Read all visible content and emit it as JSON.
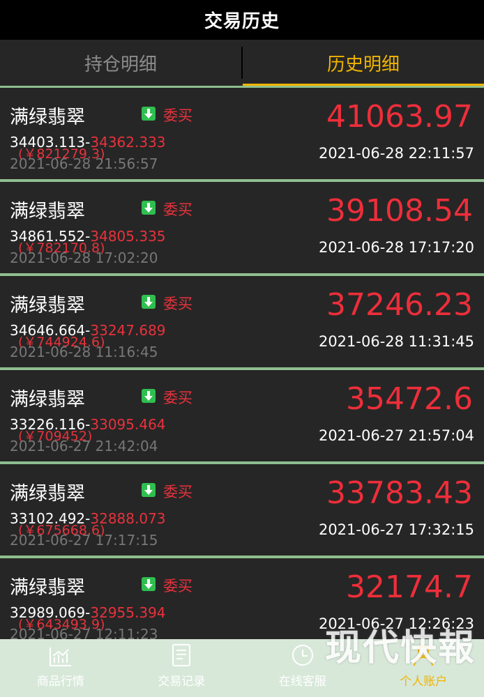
{
  "header": {
    "title": "交易历史"
  },
  "tabs": [
    {
      "label": "持仓明细",
      "active": false
    },
    {
      "label": "历史明细",
      "active": true
    }
  ],
  "trades": [
    {
      "name": "满绿翡翠",
      "type": "委买",
      "open_price": "34403.113-",
      "close_price": "34362.333",
      "amount": "(￥821279.3)",
      "open_time": "2021-06-28 21:56:57",
      "value": "41063.97",
      "close_time": "2021-06-28 22:11:57"
    },
    {
      "name": "满绿翡翠",
      "type": "委买",
      "open_price": "34861.552-",
      "close_price": "34805.335",
      "amount": "(￥782170.8)",
      "open_time": "2021-06-28 17:02:20",
      "value": "39108.54",
      "close_time": "2021-06-28 17:17:20"
    },
    {
      "name": "满绿翡翠",
      "type": "委买",
      "open_price": "34646.664-",
      "close_price": "33247.689",
      "amount": "(￥744924.6)",
      "open_time": "2021-06-28 11:16:45",
      "value": "37246.23",
      "close_time": "2021-06-28 11:31:45"
    },
    {
      "name": "满绿翡翠",
      "type": "委买",
      "open_price": "33226.116-",
      "close_price": "33095.464",
      "amount": "(￥709452)",
      "open_time": "2021-06-27 21:42:04",
      "value": "35472.6",
      "close_time": "2021-06-27 21:57:04"
    },
    {
      "name": "满绿翡翠",
      "type": "委买",
      "open_price": "33102.492-",
      "close_price": "32888.073",
      "amount": "(￥675668.6)",
      "open_time": "2021-06-27 17:17:15",
      "value": "33783.43",
      "close_time": "2021-06-27 17:32:15"
    },
    {
      "name": "满绿翡翠",
      "type": "委买",
      "open_price": "32989.069-",
      "close_price": "32955.394",
      "amount": "(￥643493.9)",
      "open_time": "2021-06-27 12:11:23",
      "value": "32174.7",
      "close_time": "2021-06-27 12:26:23"
    }
  ],
  "bottom_nav": [
    {
      "label": "商品行情",
      "icon": "chart-icon",
      "active": false
    },
    {
      "label": "交易记录",
      "icon": "document-icon",
      "active": false
    },
    {
      "label": "在线客服",
      "icon": "clock-icon",
      "active": false
    },
    {
      "label": "个人账户",
      "icon": "user-icon",
      "active": true
    }
  ],
  "watermark": "现代快報",
  "colors": {
    "accent": "#f0b400",
    "loss_red": "#ee2e3a",
    "buy_green": "#2fbf4f",
    "card_bg": "#262626"
  }
}
